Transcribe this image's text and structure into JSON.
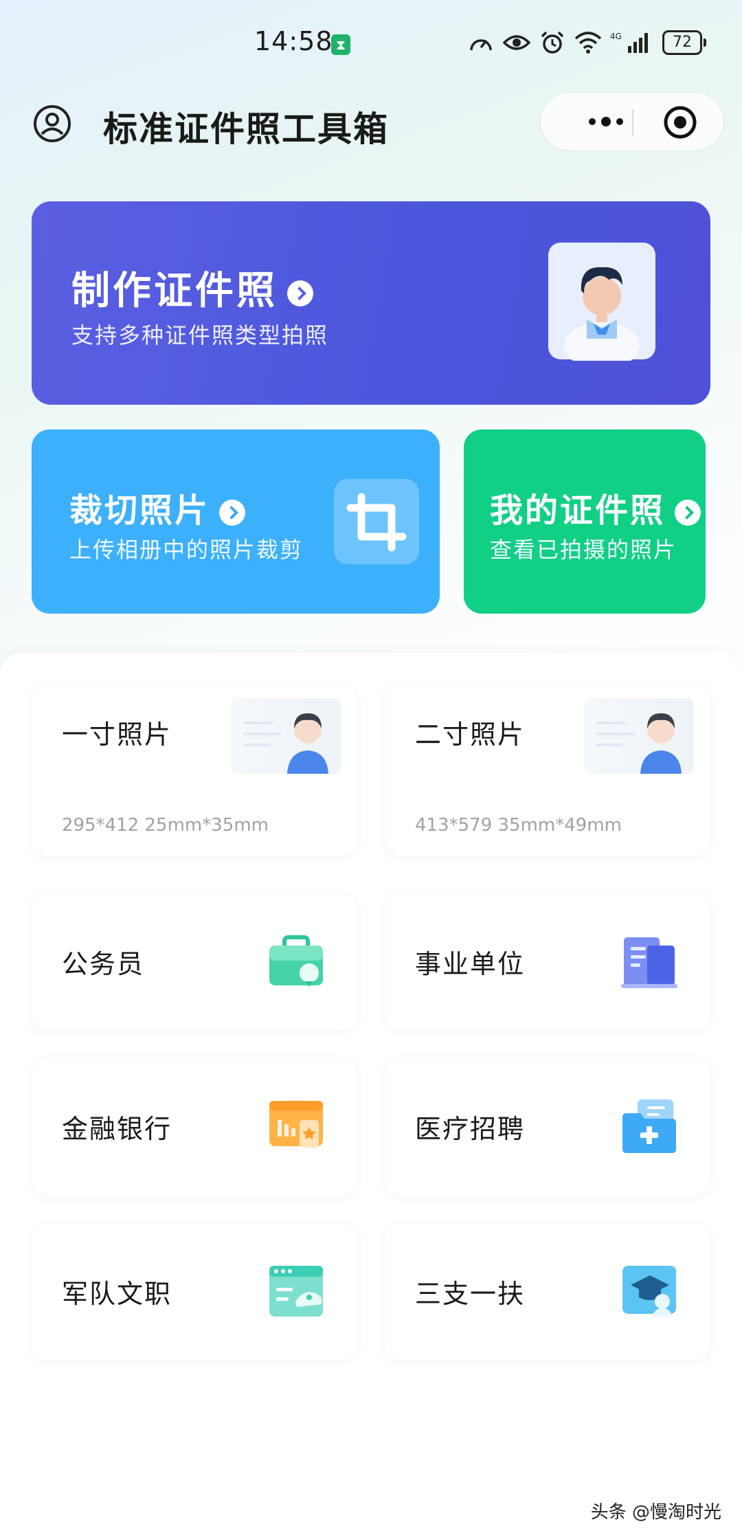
{
  "status_bar": {
    "time": "14:58",
    "network": "4G",
    "battery": "72"
  },
  "header": {
    "title": "标准证件照工具箱"
  },
  "banners": {
    "make": {
      "title": "制作证件照",
      "subtitle": "支持多种证件照类型拍照"
    },
    "crop": {
      "title": "裁切照片",
      "subtitle": "上传相册中的照片裁剪"
    },
    "mine": {
      "title": "我的证件照",
      "subtitle": "查看已拍摄的照片"
    }
  },
  "photo_sizes": [
    {
      "name": "一寸照片",
      "spec": "295*412 25mm*35mm"
    },
    {
      "name": "二寸照片",
      "spec": "413*579 35mm*49mm"
    }
  ],
  "categories": [
    {
      "name": "公务员",
      "icon": "briefcase-icon"
    },
    {
      "name": "事业单位",
      "icon": "building-icon"
    },
    {
      "name": "金融银行",
      "icon": "bank-card-icon"
    },
    {
      "name": "医疗招聘",
      "icon": "medical-folder-icon"
    },
    {
      "name": "军队文职",
      "icon": "military-cap-icon"
    },
    {
      "name": "三支一扶",
      "icon": "graduation-cap-icon"
    }
  ],
  "watermark": "头条 @慢淘时光",
  "colors": {
    "make_banner": "#5a5fe1",
    "crop_banner": "#3db0fb",
    "mine_banner": "#12cf86"
  }
}
